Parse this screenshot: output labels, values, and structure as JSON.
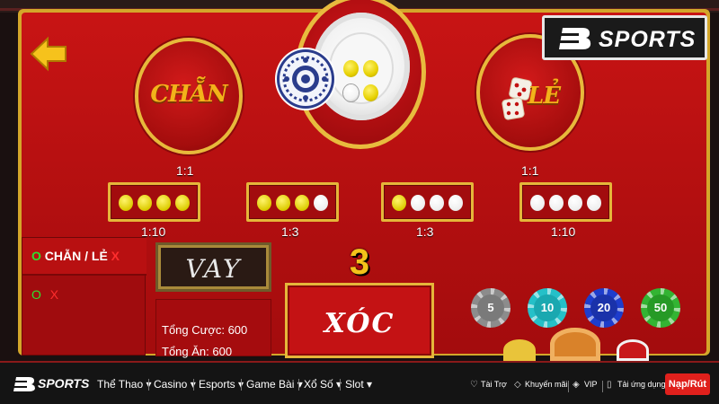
{
  "game": {
    "back_label": "",
    "chan_label": "CHẴN",
    "le_label": "LẺ",
    "chan_ratio": "1:1",
    "le_ratio": "1:1",
    "plate_coins": [
      "yellow",
      "yellow",
      "white",
      "yellow"
    ],
    "countdown": "3",
    "vay_label": "VAY",
    "xoc_label": "XÓC",
    "bets": [
      {
        "ratio": "1:10",
        "coins": [
          "yellow",
          "yellow",
          "yellow",
          "yellow"
        ]
      },
      {
        "ratio": "1:3",
        "coins": [
          "yellow",
          "yellow",
          "yellow",
          "white"
        ]
      },
      {
        "ratio": "1:3",
        "coins": [
          "yellow",
          "white",
          "white",
          "white"
        ]
      },
      {
        "ratio": "1:10",
        "coins": [
          "white",
          "white",
          "white",
          "white"
        ]
      }
    ],
    "history": {
      "header_o": "O",
      "header_text": "CHẴN / LẺ",
      "header_x": "X",
      "row_o": "O",
      "row_x": "X"
    },
    "totals": {
      "bet_label": "Tổng Cược: 600",
      "win_label": "Tổng Ăn: 600"
    },
    "chips": [
      "5",
      "10",
      "20",
      "50"
    ]
  },
  "logo": {
    "text": "SPORTS"
  },
  "nav": {
    "brand": "SPORTS",
    "items": [
      "Thể Thao",
      "Casino",
      "Esports",
      "Game Bài",
      "Xổ Số",
      "Slot"
    ],
    "right": [
      "Tài Trợ",
      "Khuyến mãi",
      "VIP",
      "Tải ứng dụng"
    ],
    "cta": "Nạp/Rút"
  },
  "colors": {
    "table": "#c81414",
    "gold": "#e5b63a",
    "chip5": "#8c8c8c",
    "chip10": "#25c0c8",
    "chip20": "#1e3dcc",
    "chip50": "#33b433",
    "cta": "#e0201c"
  }
}
